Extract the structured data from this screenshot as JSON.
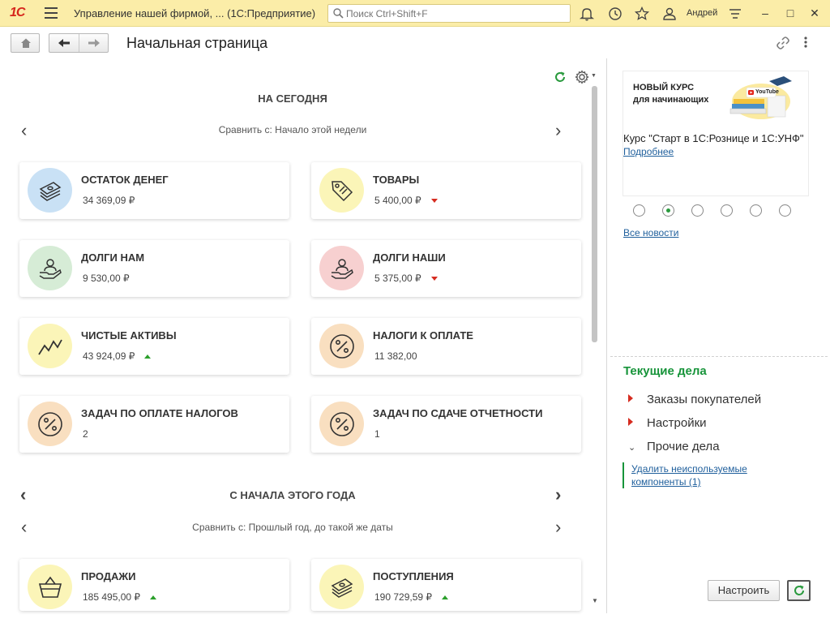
{
  "titlebar": {
    "logo": "1С",
    "app_title": "Управление нашей фирмой, ...   (1С:Предприятие)",
    "search_placeholder": "Поиск Ctrl+Shift+F",
    "user": "Андрей"
  },
  "nav": {
    "page_title": "Начальная страница"
  },
  "today": {
    "title": "НА СЕГОДНЯ",
    "compare": "Сравнить с: Начало этой недели",
    "cards": [
      {
        "title": "ОСТАТОК ДЕНЕГ",
        "value": "34 369,09 ₽",
        "trend": "none",
        "icon": "money-stack-icon",
        "color": "#c9e1f5"
      },
      {
        "title": "ТОВАРЫ",
        "value": "5 400,00 ₽",
        "trend": "down",
        "icon": "price-tag-icon",
        "color": "#fbf5b8"
      },
      {
        "title": "ДОЛГИ НАМ",
        "value": "9 530,00 ₽",
        "trend": "none",
        "icon": "hand-person-icon",
        "color": "#d6ecd6"
      },
      {
        "title": "ДОЛГИ НАШИ",
        "value": "5 375,00 ₽",
        "trend": "down",
        "icon": "hand-person-icon",
        "color": "#f7d0d0"
      },
      {
        "title": "ЧИСТЫЕ АКТИВЫ",
        "value": "43 924,09 ₽",
        "trend": "up",
        "icon": "zigzag-chart-icon",
        "color": "#fbf5b8"
      },
      {
        "title": "НАЛОГИ К ОПЛАТЕ",
        "value": "11 382,00",
        "trend": "none",
        "icon": "percent-icon",
        "color": "#f9dfc0"
      },
      {
        "title": "ЗАДАЧ ПО ОПЛАТЕ НАЛОГОВ",
        "value": "2",
        "trend": "none",
        "icon": "percent-icon",
        "color": "#f9dfc0"
      },
      {
        "title": "ЗАДАЧ ПО СДАЧЕ ОТЧЕТНОСТИ",
        "value": "1",
        "trend": "none",
        "icon": "percent-icon",
        "color": "#f9dfc0"
      }
    ]
  },
  "year": {
    "title": "С НАЧАЛА ЭТОГО ГОДА",
    "compare": "Сравнить с: Прошлый год, до такой же даты",
    "cards": [
      {
        "title": "ПРОДАЖИ",
        "value": "185 495,00 ₽",
        "trend": "up",
        "icon": "basket-icon",
        "color": "#fbf5b8"
      },
      {
        "title": "ПОСТУПЛЕНИЯ",
        "value": "190 729,59 ₽",
        "trend": "up",
        "icon": "money-stack-icon",
        "color": "#fbf5b8"
      }
    ]
  },
  "news": {
    "banner_line1": "НОВЫЙ КУРС",
    "banner_line2": "для начинающих",
    "banner_badge": "YouTube",
    "title": "Курс \"Старт в 1С:Рознице и 1С:УНФ\"",
    "more": "Подробнее",
    "all_news": "Все новости",
    "active_dot": 1,
    "dot_count": 6
  },
  "tasks": {
    "title": "Текущие дела",
    "items": [
      {
        "label": "Заказы покупателей",
        "state": "collapsed"
      },
      {
        "label": "Настройки",
        "state": "collapsed"
      },
      {
        "label": "Прочие дела",
        "state": "expanded"
      }
    ],
    "subtask_line1": "Удалить неиспользуемые",
    "subtask_line2": "компоненты (1)",
    "setup_button": "Настроить"
  }
}
